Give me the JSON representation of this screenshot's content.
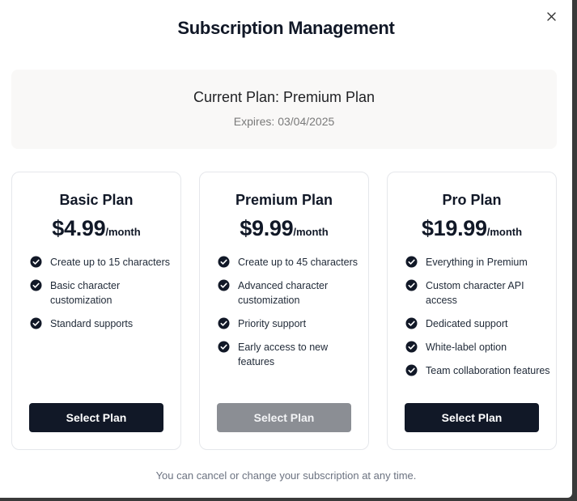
{
  "modal": {
    "title": "Subscription Management",
    "close_icon": "close-icon"
  },
  "current_plan": {
    "label": "Current Plan: Premium Plan",
    "expires": "Expires: 03/04/2025"
  },
  "plans": [
    {
      "name": "Basic Plan",
      "price": "$4.99",
      "period": "/month",
      "features": [
        "Create up to 15 characters",
        "Basic character customization",
        "Standard supports"
      ],
      "button_label": "Select Plan",
      "button_disabled": false
    },
    {
      "name": "Premium Plan",
      "price": "$9.99",
      "period": "/month",
      "features": [
        "Create up to 45 characters",
        "Advanced character customization",
        "Priority support",
        "Early access to new features"
      ],
      "button_label": "Select Plan",
      "button_disabled": true
    },
    {
      "name": "Pro Plan",
      "price": "$19.99",
      "period": "/month",
      "features": [
        "Everything in Premium",
        "Custom character API access",
        "Dedicated support",
        "White-label option",
        "Team collaboration features"
      ],
      "button_label": "Select Plan",
      "button_disabled": false
    }
  ],
  "footer": {
    "note": "You can cancel or change your subscription at any time."
  },
  "colors": {
    "primary": "#111827",
    "disabled": "#8b8e94",
    "muted_text": "#6b7280",
    "panel_bg": "#f9f8f7"
  }
}
